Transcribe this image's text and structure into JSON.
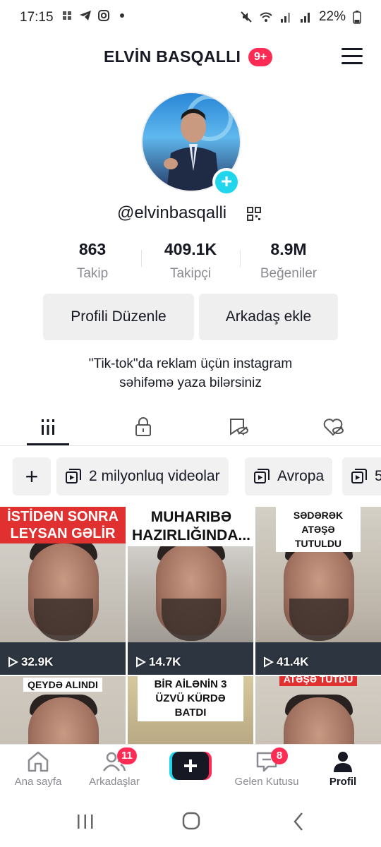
{
  "status": {
    "time": "17:15",
    "battery": "22%"
  },
  "header": {
    "title": "ELVİN BASQALLI",
    "notif_badge": "9+"
  },
  "profile": {
    "handle": "@elvinbasqalli"
  },
  "stats": [
    {
      "value": "863",
      "label": "Takip"
    },
    {
      "value": "409.1K",
      "label": "Takipçi"
    },
    {
      "value": "8.9M",
      "label": "Beğeniler"
    }
  ],
  "buttons": {
    "edit": "Profili Düzenle",
    "add_friend": "Arkadaş ekle"
  },
  "bio": [
    "\"Tik-tok\"da reklam üçün instagram",
    "səhifəmə yaza bilərsiniz"
  ],
  "playlists": {
    "add": "+",
    "items": [
      "2 milyonluq videolar",
      "Avropa",
      "5"
    ]
  },
  "videos": [
    {
      "caption": "İSTİDƏN SONRA LEYSAN GƏLİR",
      "views": "32.9K"
    },
    {
      "caption": "MUHARIBƏ HAZIRLIĞINDA...",
      "views": "14.7K"
    },
    {
      "caption": "SƏDƏRƏK ATƏŞƏ TUTULDU",
      "views": "41.4K"
    },
    {
      "caption": "QEYDƏ ALINDI",
      "views": ""
    },
    {
      "caption": "BİR AİLƏNİN 3 ÜZVÜ KÜRDƏ BATDI",
      "views": ""
    },
    {
      "caption": "ATƏŞƏ TUTDU",
      "views": ""
    }
  ],
  "nav": {
    "home": "Ana sayfa",
    "friends": "Arkadaşlar",
    "friends_badge": "11",
    "inbox": "Gelen Kutusu",
    "inbox_badge": "8",
    "profile": "Profil"
  },
  "colors": {
    "accent": "#fe2c55",
    "cyan": "#20d5ec"
  }
}
